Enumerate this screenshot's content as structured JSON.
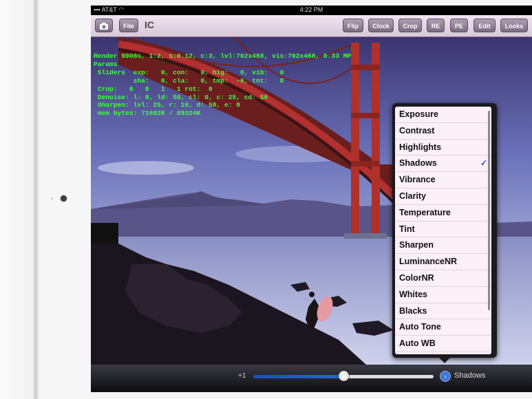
{
  "statusbar": {
    "carrier": "AT&T",
    "time": "4:22 PM"
  },
  "toolbar": {
    "title": "IC",
    "file_label": "File",
    "buttons": [
      "Flip",
      "Clock",
      "Crop",
      "RE",
      "PE",
      "Edit",
      "Looks"
    ]
  },
  "overlay": {
    "lines": [
      "Render 9008s, 1:2, s:0.12, c:3, lvl:702x468, vis:702x468, 0.33 MP",
      "Params",
      " Sliders  exp:   0, con:   0, hig:   0, vib:   0",
      "          sha:   0, cla:   0, tmp:  -6, tnt:   8",
      " Crop:   0   0   1   1 rot:  0",
      " Denoise: l: 0, ld: 50, cl: 0, c: 25, cd: 50",
      " Sharpen: lvl: 25, r: 10, d: 50, e: 0",
      " mem bytes: 71692K / 89324K"
    ]
  },
  "menu": {
    "items": [
      "Exposure",
      "Contrast",
      "Highlights",
      "Shadows",
      "Vibrance",
      "Clarity",
      "Temperature",
      "Tint",
      "Sharpen",
      "LuminanceNR",
      "ColorNR",
      "Whites",
      "Blacks",
      "Auto Tone",
      "Auto WB"
    ],
    "selected": "Shadows",
    "check": "✓"
  },
  "slider": {
    "min_label": "+1",
    "value_fraction": 0.5,
    "selected_label": "Shadows"
  }
}
